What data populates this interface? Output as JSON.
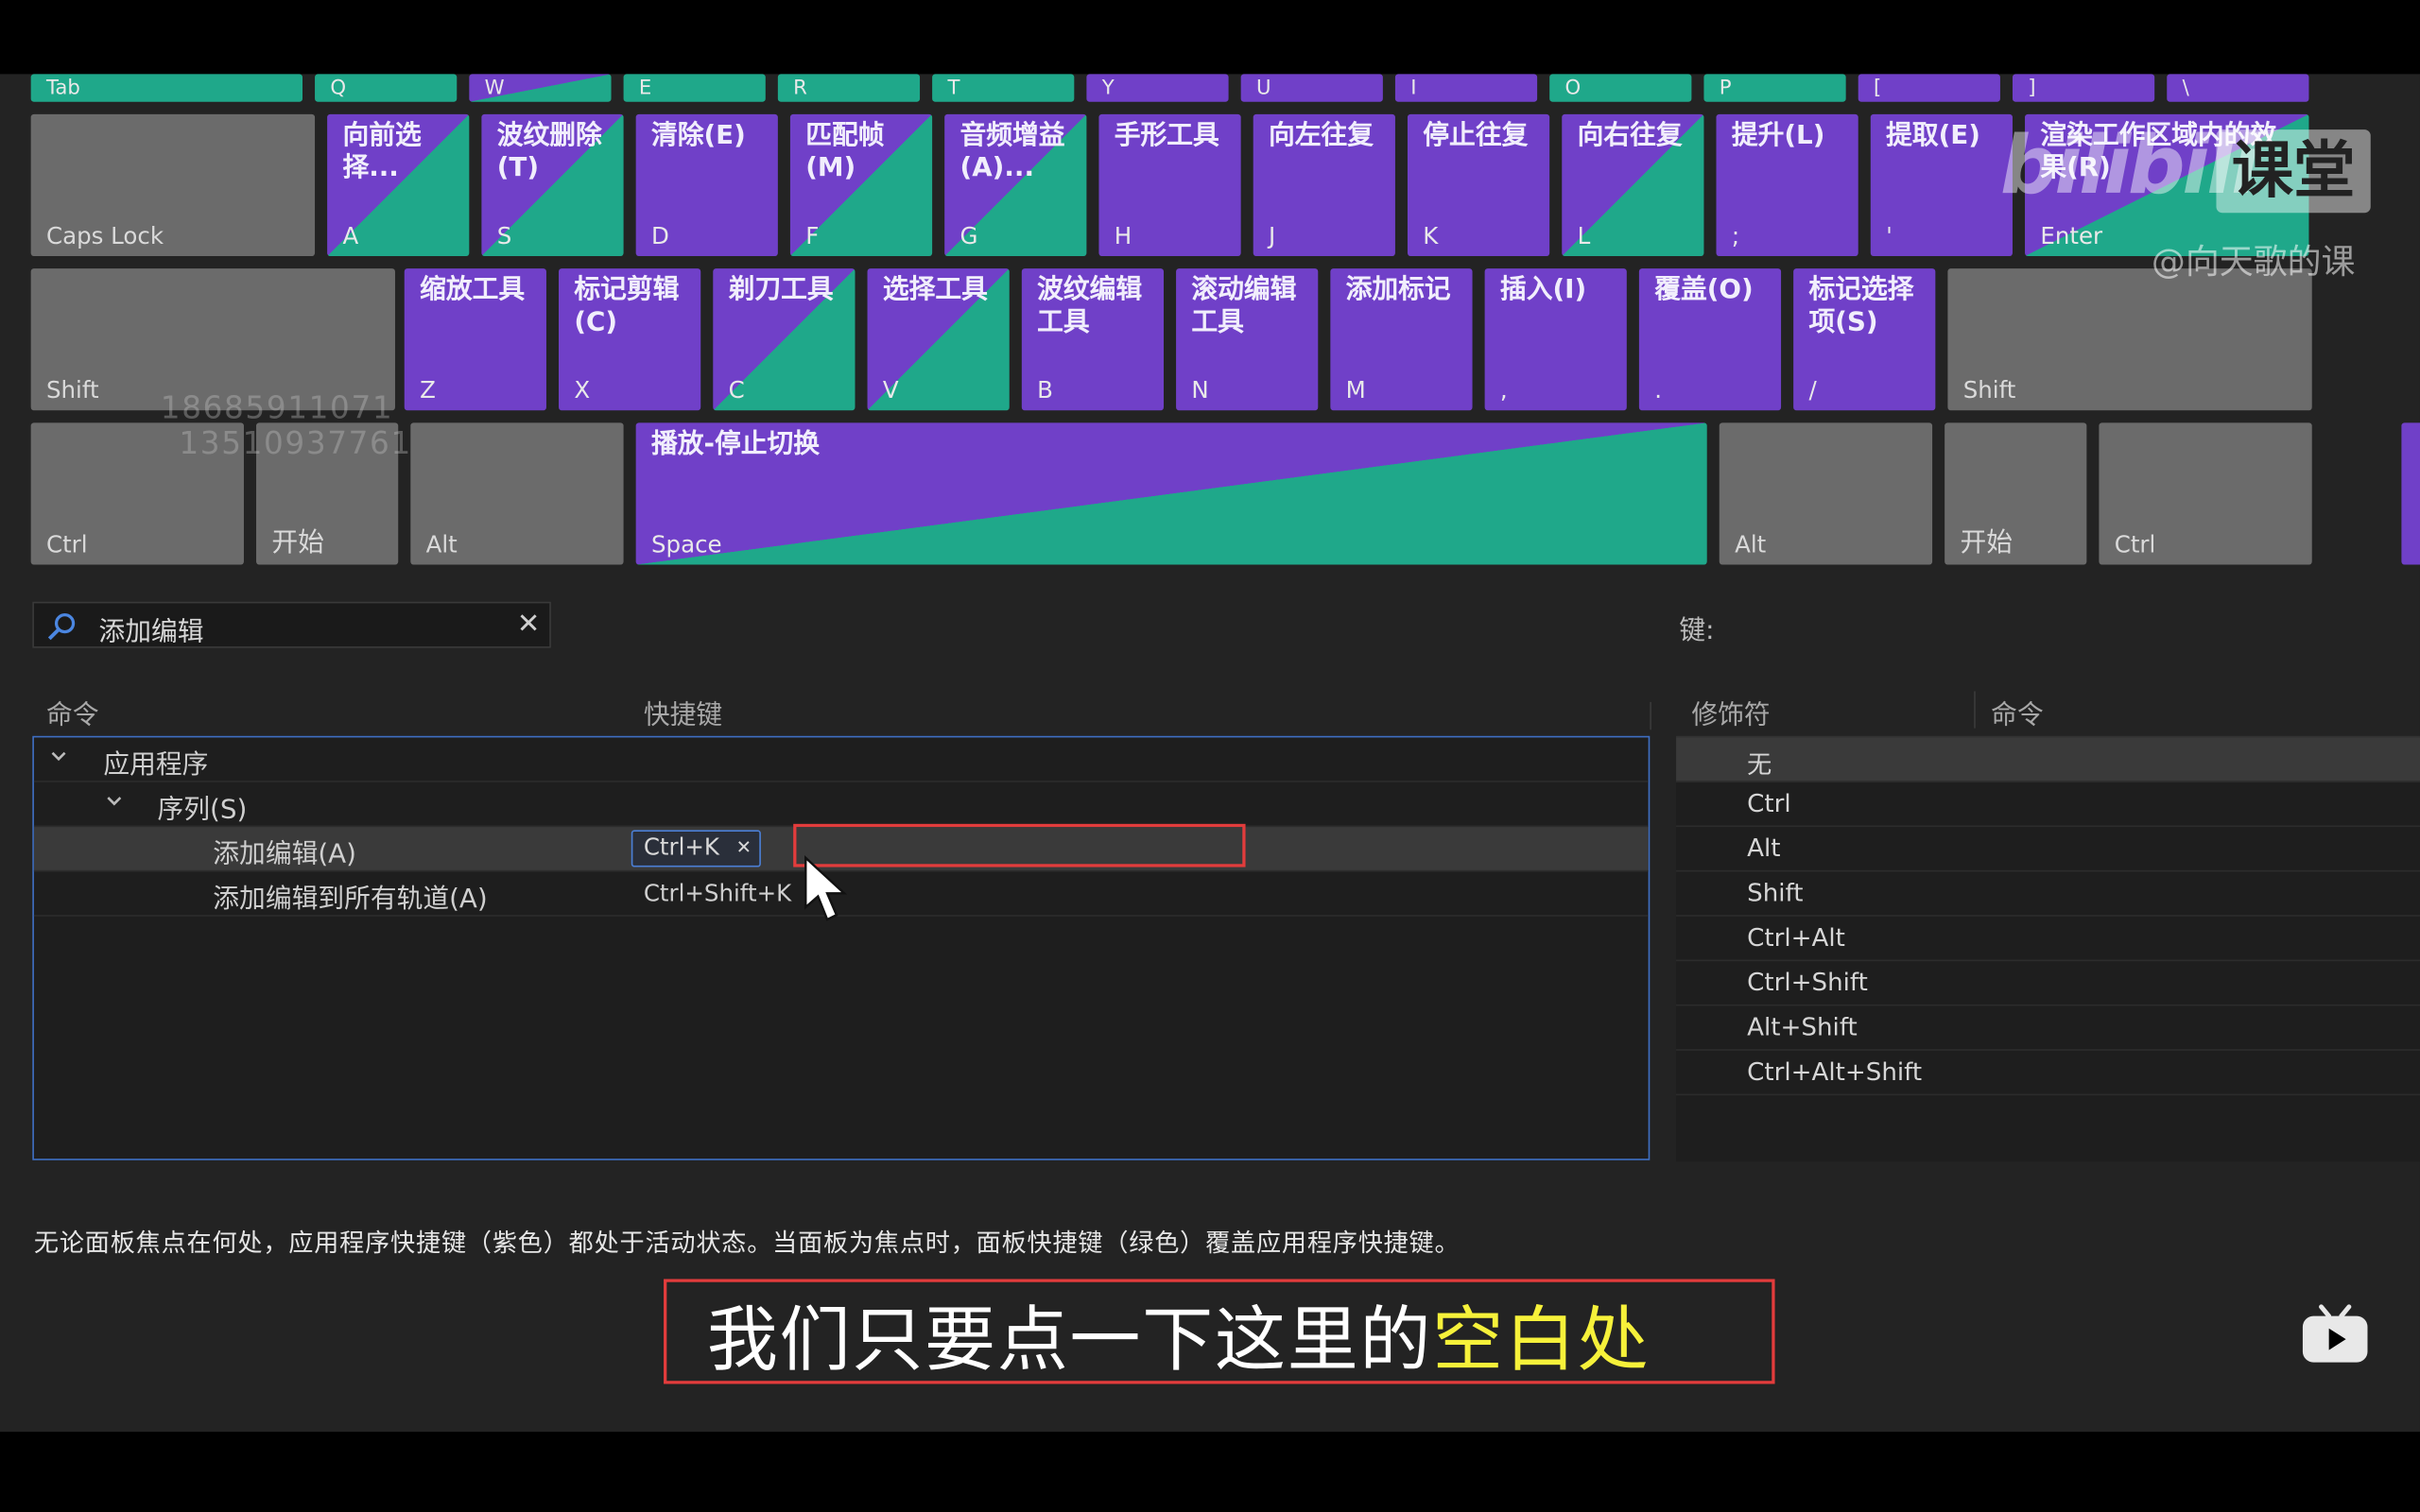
{
  "keyboard": {
    "row1": [
      "Tab",
      "Q",
      "W",
      "E",
      "R",
      "T",
      "Y",
      "U",
      "I",
      "O",
      "P",
      "[",
      "]",
      "\\"
    ],
    "row2": [
      {
        "label": "",
        "cap": "Caps Lock"
      },
      {
        "label": "向前选择...",
        "cap": "A"
      },
      {
        "label": "波纹删除(T)",
        "cap": "S"
      },
      {
        "label": "清除(E)",
        "cap": "D"
      },
      {
        "label": "匹配帧(M)",
        "cap": "F"
      },
      {
        "label": "音频增益(A)...",
        "cap": "G"
      },
      {
        "label": "手形工具",
        "cap": "H"
      },
      {
        "label": "向左往复",
        "cap": "J"
      },
      {
        "label": "停止往复",
        "cap": "K"
      },
      {
        "label": "向右往复",
        "cap": "L"
      },
      {
        "label": "提升(L)",
        "cap": ";"
      },
      {
        "label": "提取(E)",
        "cap": "'"
      },
      {
        "label": "渲染工作区域内的效果(R)",
        "cap": "Enter"
      }
    ],
    "row3": [
      {
        "label": "",
        "cap": "Shift"
      },
      {
        "label": "缩放工具",
        "cap": "Z"
      },
      {
        "label": "标记剪辑(C)",
        "cap": "X"
      },
      {
        "label": "剃刀工具",
        "cap": "C"
      },
      {
        "label": "选择工具",
        "cap": "V"
      },
      {
        "label": "波纹编辑工具",
        "cap": "B"
      },
      {
        "label": "滚动编辑工具",
        "cap": "N"
      },
      {
        "label": "添加标记",
        "cap": "M"
      },
      {
        "label": "插入(I)",
        "cap": ","
      },
      {
        "label": "覆盖(O)",
        "cap": "."
      },
      {
        "label": "标记选择项(S)",
        "cap": "/"
      },
      {
        "label": "",
        "cap": "Shift"
      }
    ],
    "row4": [
      {
        "label": "",
        "cap": "Ctrl"
      },
      {
        "label": "",
        "cap": "开始"
      },
      {
        "label": "",
        "cap": "Alt"
      },
      {
        "label": "播放-停止切换",
        "cap": "Space"
      },
      {
        "label": "",
        "cap": "Alt"
      },
      {
        "label": "",
        "cap": "开始"
      },
      {
        "label": "",
        "cap": "Ctrl"
      }
    ]
  },
  "watermark_numbers": [
    "18685911071",
    "13510937761"
  ],
  "search": {
    "value": "添加编辑"
  },
  "key_label": "键:",
  "columns": {
    "command": "命令",
    "shortcut": "快捷键",
    "modifier": "修饰符",
    "command2": "命令"
  },
  "tree": {
    "root": "应用程序",
    "group": "序列(S)",
    "rows": [
      {
        "command": "添加编辑(A)",
        "shortcut": "Ctrl+K"
      },
      {
        "command": "添加编辑到所有轨道(A)",
        "shortcut": "Ctrl+Shift+K"
      }
    ]
  },
  "modifiers": [
    "无",
    "Ctrl",
    "Alt",
    "Shift",
    "Ctrl+Alt",
    "Ctrl+Shift",
    "Alt+Shift",
    "Ctrl+Alt+Shift"
  ],
  "note": "无论面板焦点在何处，应用程序快捷键（紫色）都处于活动状态。当面板为焦点时，面板快捷键（绿色）覆盖应用程序快捷键。",
  "subtitle": {
    "main": "我们只要点一下这里的",
    "highlight": "空白处"
  },
  "brand": {
    "logo": "bilibili",
    "logo_box": "课堂",
    "handle": "@向天歌的课"
  },
  "colors": {
    "app_shortcut": "#7040c8",
    "panel_shortcut": "#1fa88a",
    "focus": "#4b7fd6",
    "highlight_box": "#e23c3c",
    "subtitle_highlight": "#f6f13a"
  }
}
